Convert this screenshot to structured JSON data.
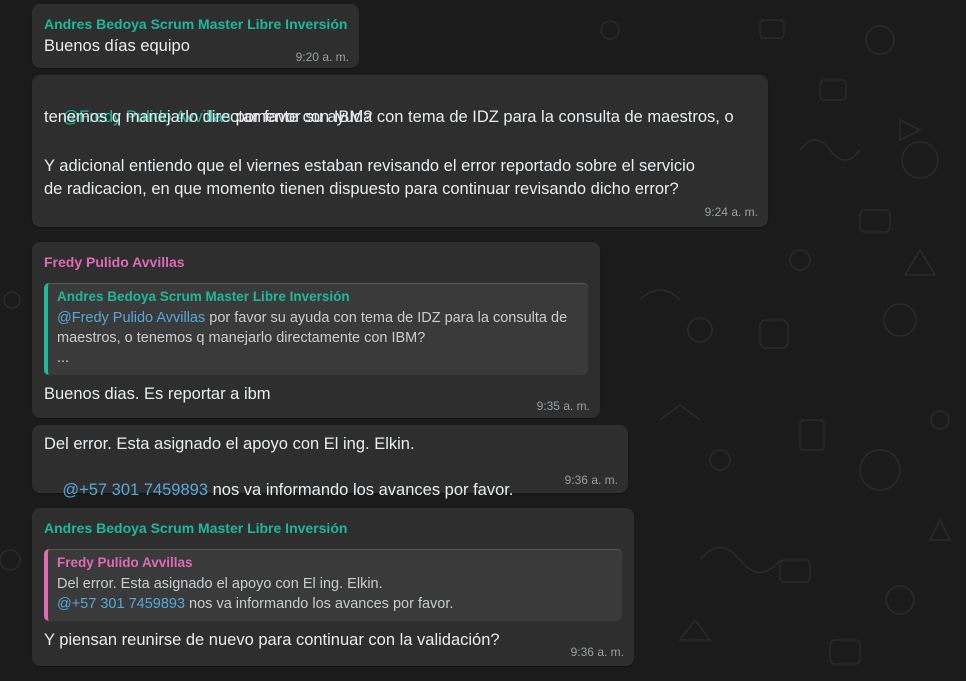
{
  "messages": [
    {
      "sender": "Andres Bedoya Scrum Master Libre Inversión",
      "text": "Buenos días equipo",
      "time": "9:20 a. m."
    },
    {
      "mention": "@Fredy Pulido Avvillas",
      "text_after_mention": " por favor su ayuda con tema de IDZ para la consulta de maestros, o",
      "line2": "tenemos q manejarlo directamente con IBM?",
      "line4": "Y adicional entiendo que el viernes estaban revisando el error reportado sobre el servicio",
      "line5": "de radicacion, en que momento tienen dispuesto para continuar revisando dicho error?",
      "time": "9:24 a. m."
    },
    {
      "sender": "Fredy Pulido Avvillas",
      "quote": {
        "sender": "Andres Bedoya Scrum Master Libre Inversión",
        "mention": "@Fredy Pulido Avvillas",
        "line1_rest": " por favor su ayuda con tema de IDZ para la consulta de",
        "line2": "maestros, o tenemos q manejarlo directamente con IBM?",
        "line3": "..."
      },
      "text": "Buenos dias. Es reportar a ibm",
      "time": "9:35 a. m."
    },
    {
      "line1": "Del error. Esta asignado el apoyo con El ing. Elkin.",
      "mention": "@+57 301 7459893",
      "line2_rest": " nos va informando los avances por favor.",
      "time": "9:36 a. m."
    },
    {
      "sender": "Andres Bedoya Scrum Master Libre Inversión",
      "quote": {
        "sender": "Fredy Pulido Avvillas",
        "line1": "Del error. Esta asignado el apoyo con El ing. Elkin.",
        "mention": "@+57 301 7459893",
        "line2_rest": " nos va informando los avances por favor."
      },
      "text": "Y piensan reunirse de nuevo para continuar con la validación?",
      "time": "9:36 a. m."
    }
  ]
}
